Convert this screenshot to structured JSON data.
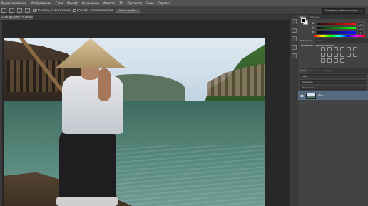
{
  "menu": [
    "Редактирование",
    "Изображение",
    "Слои",
    "Шрифт",
    "Выделение",
    "Фильтр",
    "3D",
    "Просмотр",
    "Окно",
    "Справка"
  ],
  "options_bar": {
    "auto_select_label": "Образец со всех слоев",
    "auto_enhance_label": "Усилить автоматически",
    "refine_edge_label": "Уточн. край..."
  },
  "workspace": {
    "label": "Основная рабочая среда"
  },
  "document_tab": {
    "title": "1256.jpg @ 66,7% (RGB/8#)"
  },
  "color_panel": {
    "tabs": [
      "Цвет",
      "Образцы"
    ],
    "sliders": [
      {
        "label": "R",
        "value": "19"
      },
      {
        "label": "G",
        "value": "16"
      },
      {
        "label": "B",
        "value": "13"
      }
    ]
  },
  "adjustments_panel": {
    "tabs": [
      "Коррекция",
      "Стили"
    ],
    "title": "Добавить корректировку"
  },
  "layers_panel": {
    "tabs": [
      "Слои",
      "Каналы",
      "Контуры"
    ],
    "kind_filter": "Вид",
    "blend_mode": "Обычные",
    "lock_label": "Закрепить:",
    "layers": [
      {
        "name": "Фон"
      }
    ]
  },
  "colors": {
    "menubar_bg": "#535353",
    "panel_bg": "#434343",
    "canvas_bg": "#282828",
    "selected_layer": "#556a80"
  }
}
